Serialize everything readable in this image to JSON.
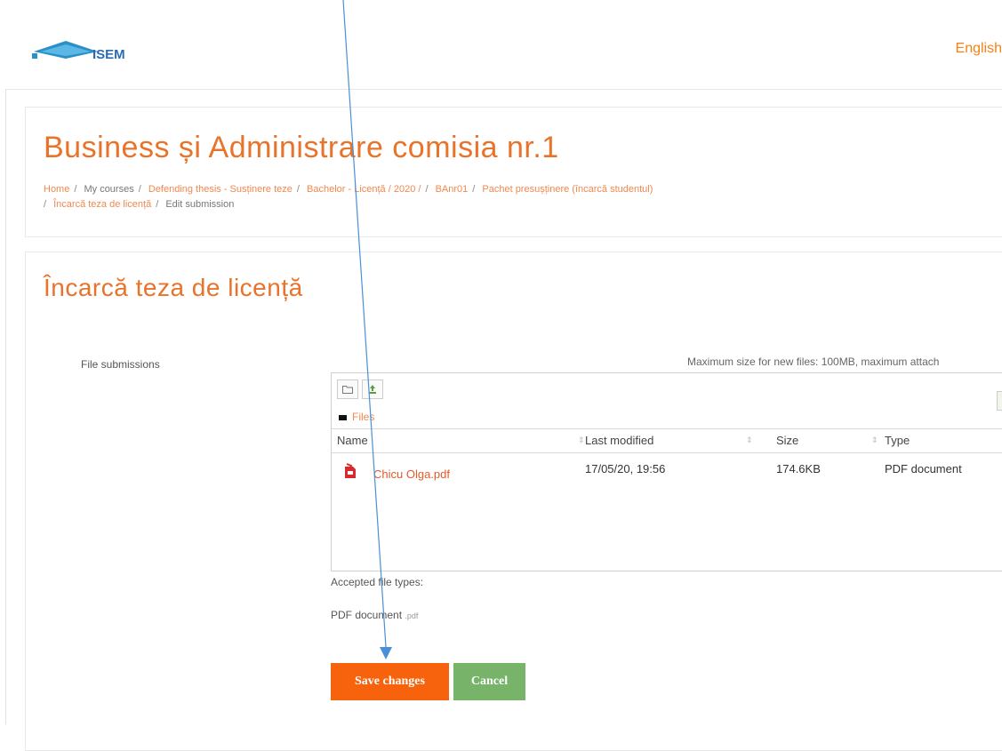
{
  "header": {
    "language": "English",
    "logo_text": "ISEM"
  },
  "page": {
    "title": "Business și Administrare comisia nr.1",
    "breadcrumb": [
      "Home",
      "My courses",
      "Defending thesis - Susținere teze",
      "Bachelor - Licență / 2020 /",
      "BAnr01",
      "Pachet presușținere (încarcă studentul)",
      "Încarcă teza de licență",
      "Edit submission"
    ]
  },
  "main": {
    "section_title": "Încarcă teza de licență",
    "field_label": "File submissions",
    "max_size_text": "Maximum size for new files: 100MB, maximum attach",
    "path_label": "Files",
    "columns": [
      "Name",
      "Last modified",
      "Size",
      "Type"
    ],
    "files": [
      {
        "name": "Chicu Olga.pdf",
        "modified": "17/05/20, 19:56",
        "size": "174.6KB",
        "type": "PDF document"
      }
    ],
    "accepted_label": "Accepted file types:",
    "accepted_type": "PDF document",
    "accepted_ext": ".pdf",
    "save_label": "Save changes",
    "cancel_label": "Cancel"
  },
  "colors": {
    "accent": "#f7630c",
    "title": "#e8732b",
    "cancel": "#77b46a",
    "annotation": "#4a8fd8"
  }
}
